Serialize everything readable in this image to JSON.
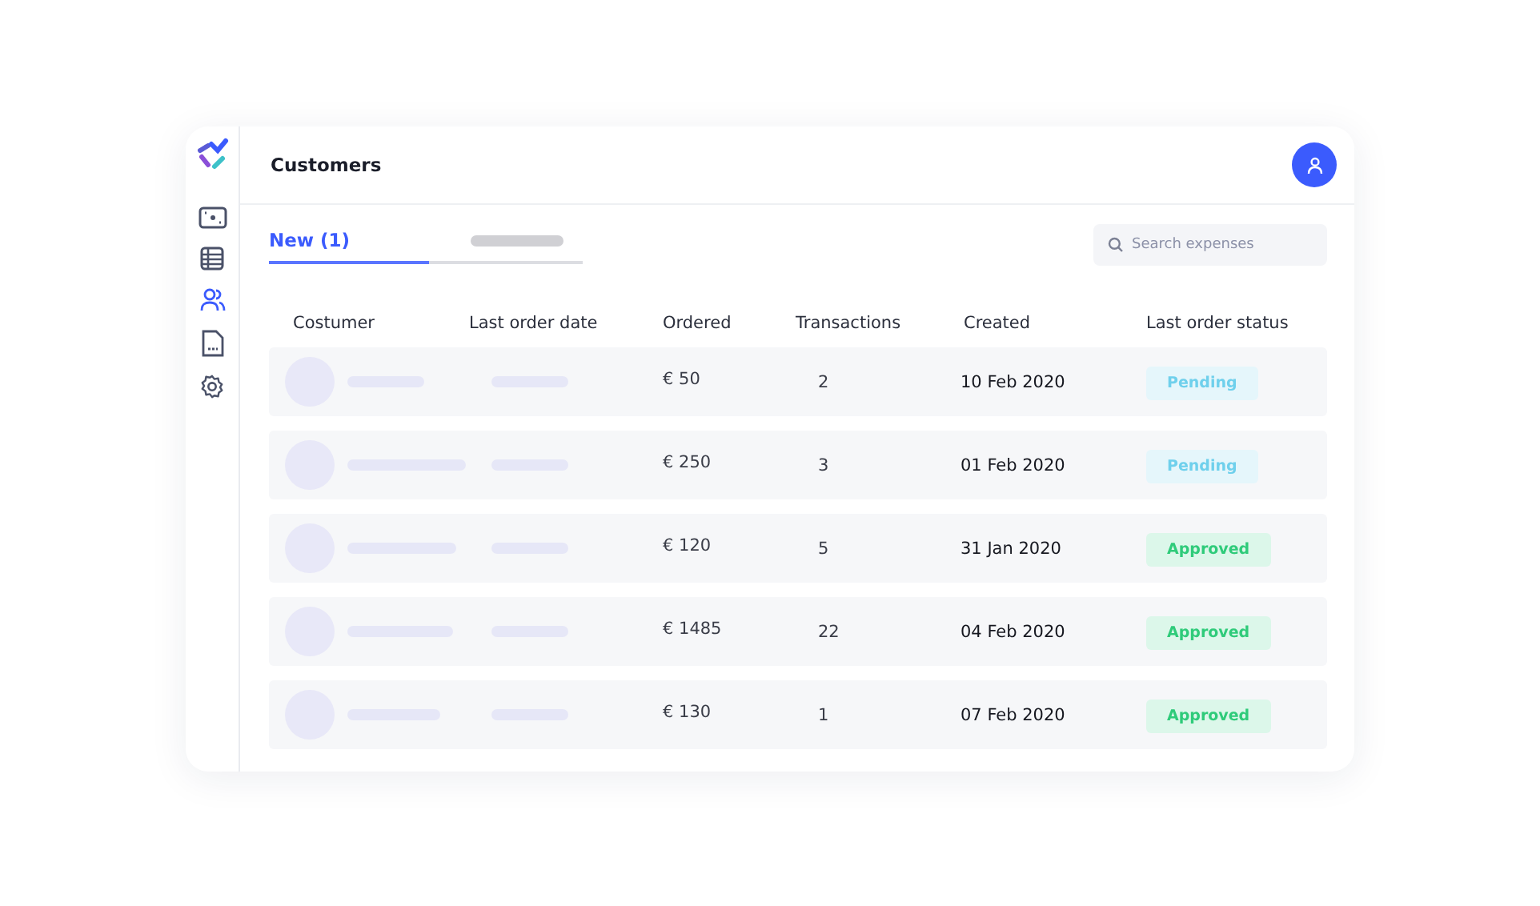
{
  "sidebar": {
    "items": [
      {
        "kind": "wallet",
        "selected": false
      },
      {
        "kind": "table",
        "selected": false
      },
      {
        "kind": "users",
        "selected": true
      },
      {
        "kind": "document",
        "selected": false
      },
      {
        "kind": "settings",
        "selected": false
      }
    ]
  },
  "header": {
    "title": "Customers"
  },
  "tabs": [
    {
      "label": "New (1)",
      "selected": true
    },
    {
      "selected": false
    }
  ],
  "search": {
    "placeholder": "Search expenses"
  },
  "table": {
    "columns": [
      "Costumer",
      "Last order date",
      "Ordered",
      "Transactions",
      "Created",
      "Last order status"
    ],
    "rows": [
      {
        "ordered": "€ 50",
        "transactions": "2",
        "created": "10 Feb 2020",
        "status": {
          "kind": "pending",
          "label": "Pending"
        }
      },
      {
        "ordered": "€ 250",
        "transactions": "3",
        "created": "01 Feb 2020",
        "status": {
          "kind": "pending",
          "label": "Pending"
        }
      },
      {
        "ordered": "€ 120",
        "transactions": "5",
        "created": "31 Jan 2020",
        "status": {
          "kind": "approved",
          "label": "Approved"
        }
      },
      {
        "ordered": "€ 1485",
        "transactions": "22",
        "created": "04 Feb 2020",
        "status": {
          "kind": "approved",
          "label": "Approved"
        }
      },
      {
        "ordered": "€ 130",
        "transactions": "1",
        "created": "07 Feb 2020",
        "status": {
          "kind": "approved",
          "label": "Approved"
        }
      }
    ]
  }
}
